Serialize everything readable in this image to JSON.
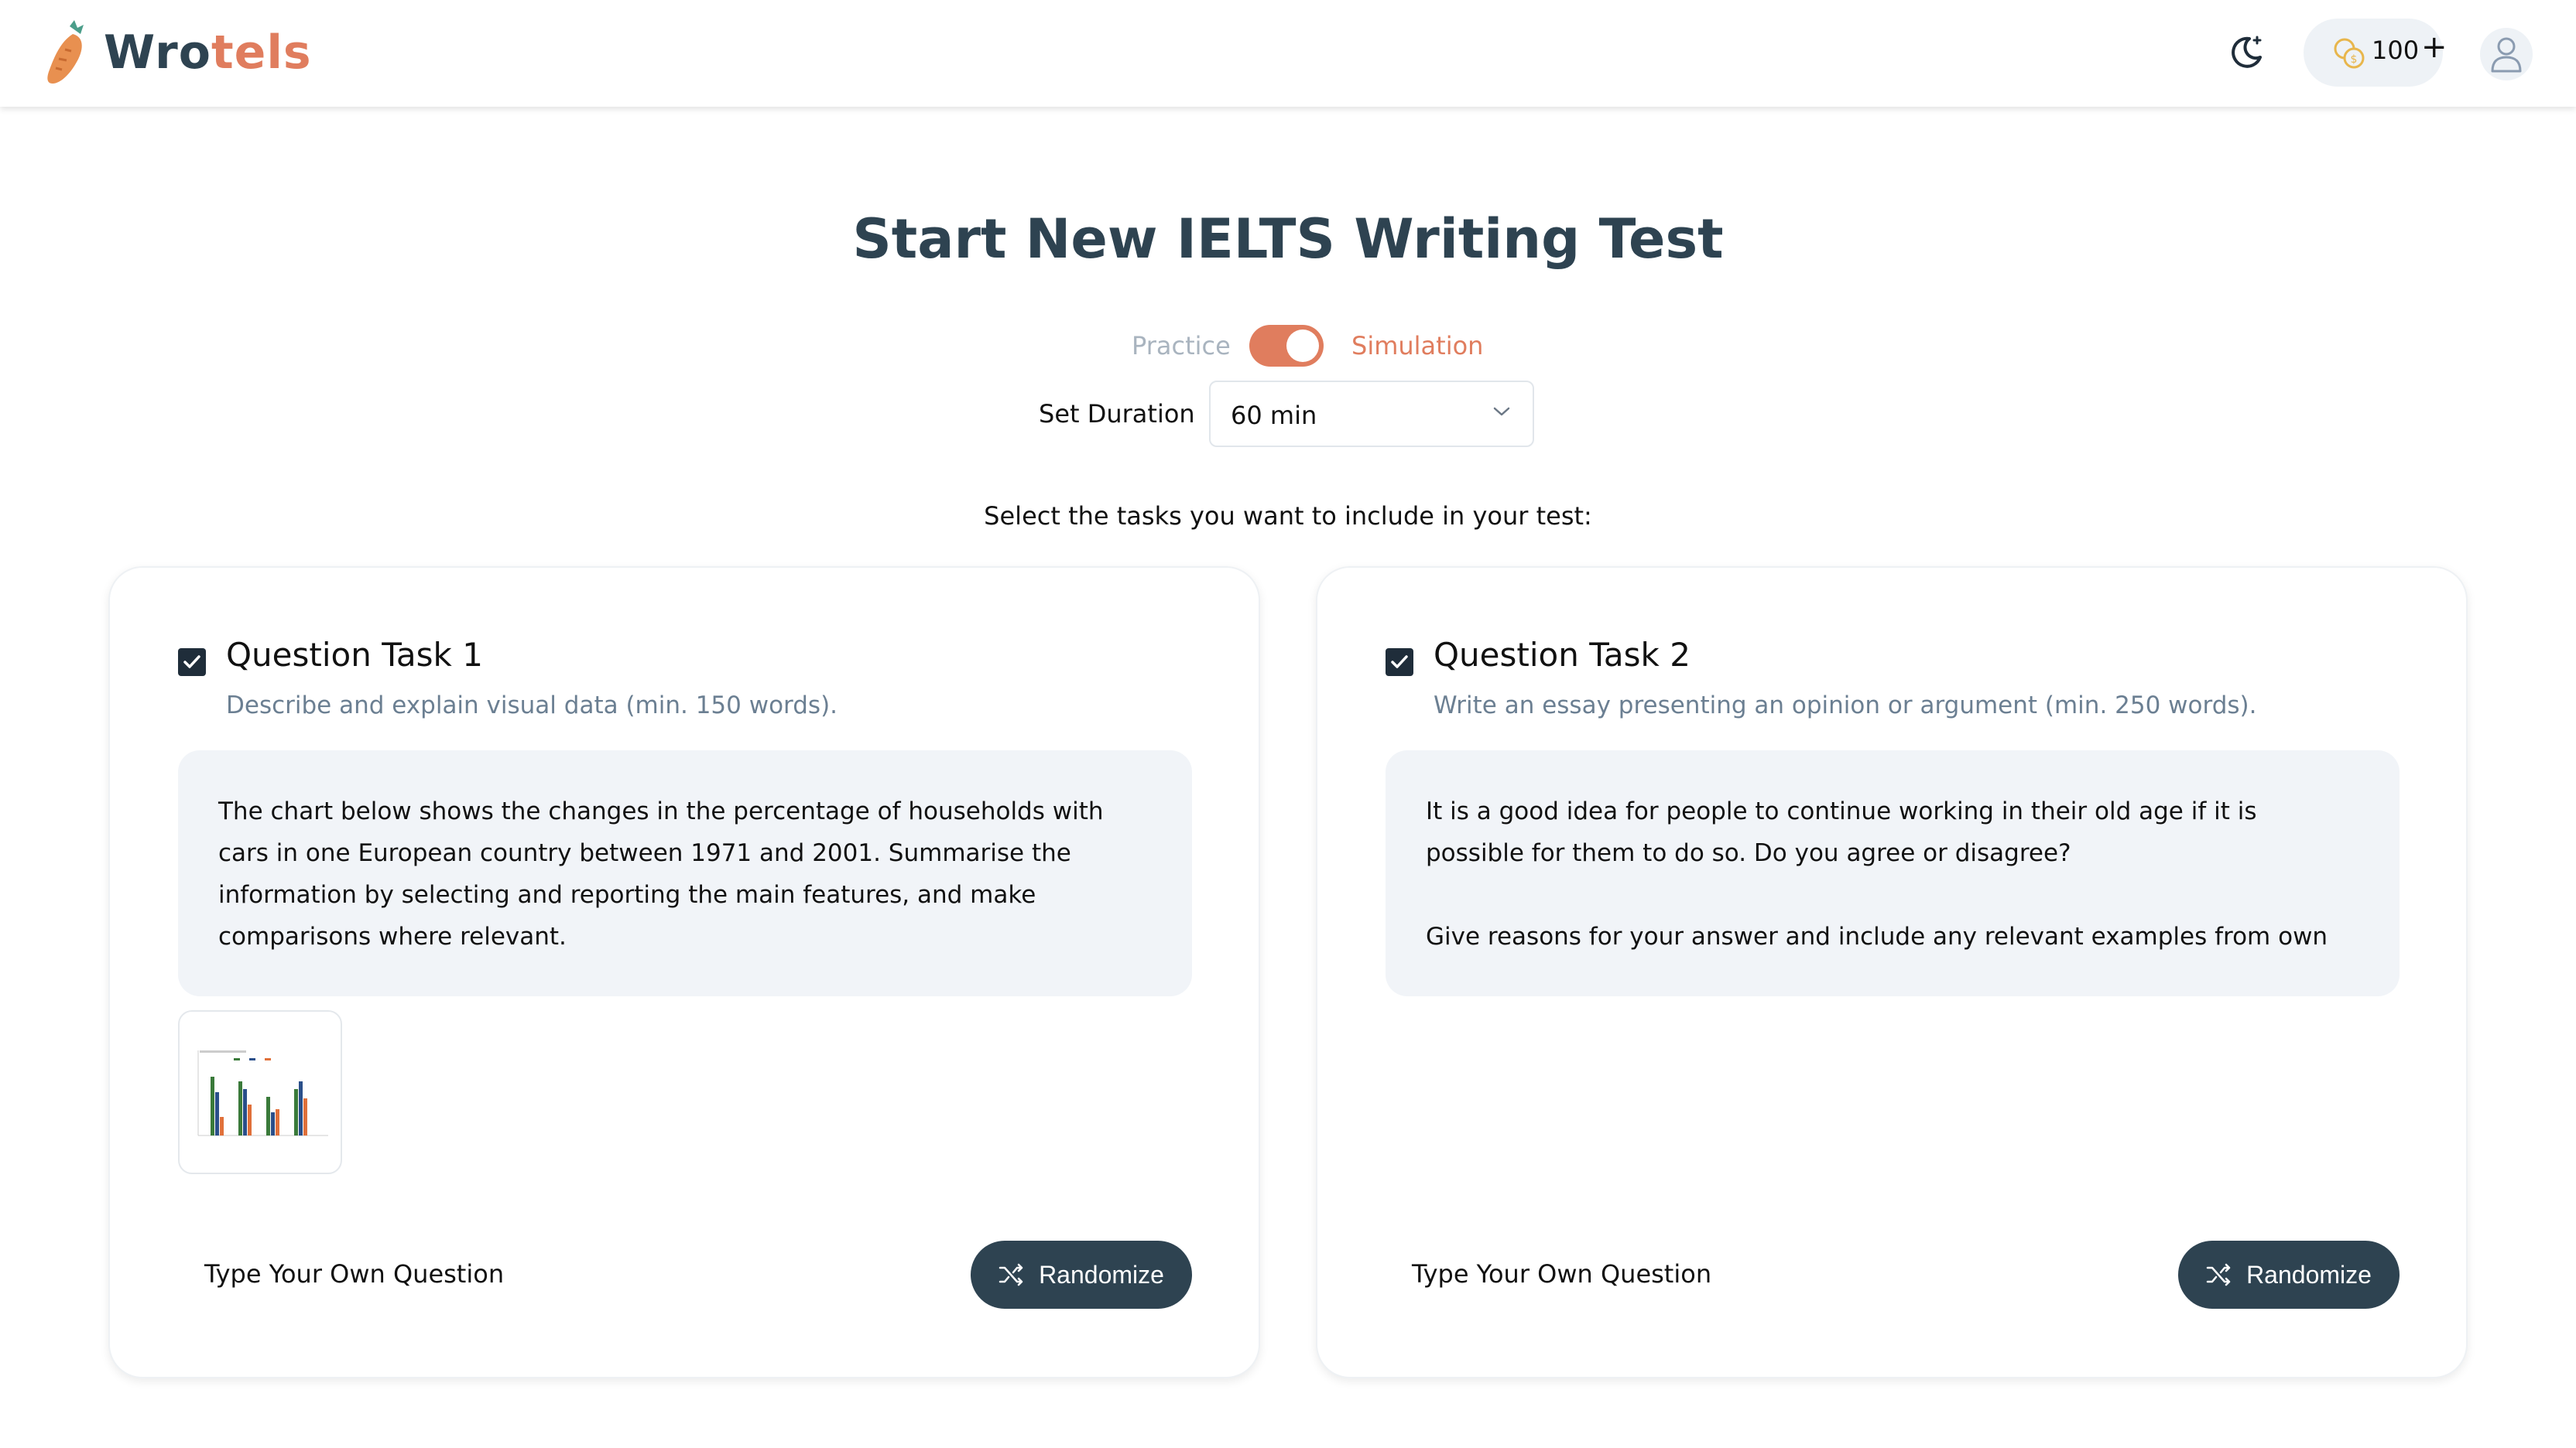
{
  "brand": {
    "name_part1": "Wro",
    "name_part2": "tels"
  },
  "header": {
    "credits": "100",
    "credits_add": "+"
  },
  "page": {
    "title": "Start New IELTS Writing Test",
    "mode_practice": "Practice",
    "mode_simulation": "Simulation",
    "mode_selected": "Simulation",
    "duration_label": "Set Duration",
    "duration_value": "60 min",
    "instructions": "Select the tasks you want to include in your test:"
  },
  "tasks": [
    {
      "title": "Question Task 1",
      "subtitle": "Describe and explain visual data (min. 150 words).",
      "checked": true,
      "prompt": [
        "The chart below shows the changes in the percentage of households with cars in one European country between 1971 and 2001. Summarise the information by selecting and reporting the main features, and make comparisons where relevant."
      ],
      "own_question": "Type Your Own Question",
      "randomize": "Randomize"
    },
    {
      "title": "Question Task 2",
      "subtitle": "Write an essay presenting an opinion or argument (min. 250 words).",
      "checked": true,
      "prompt": [
        "It is a good idea for people to continue working in their old age if it is possible for them to do so. Do you agree or disagree?",
        "Give reasons for your answer and include any relevant examples from own"
      ],
      "own_question": "Type Your Own Question",
      "randomize": "Randomize"
    }
  ],
  "colors": {
    "accent": "#e07d5e",
    "dark": "#2e4351",
    "box_bg": "#f1f4f8"
  },
  "icons": [
    "carrot-logo-icon",
    "moon-icon",
    "coins-icon",
    "user-icon",
    "chevron-down-icon",
    "check-icon",
    "shuffle-icon",
    "chart-thumbnail"
  ]
}
